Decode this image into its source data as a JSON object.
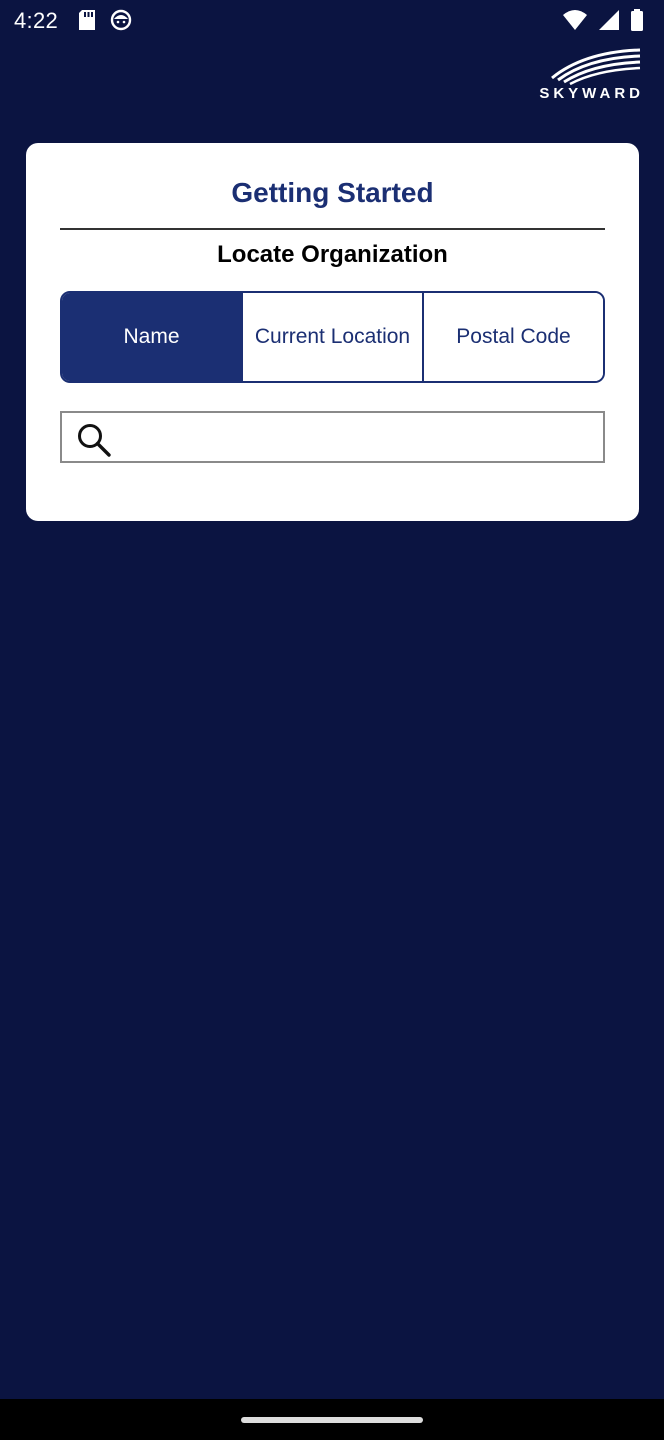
{
  "status_bar": {
    "time": "4:22",
    "icons": [
      "sd-card-icon",
      "notification-face-icon",
      "wifi-icon",
      "cellular-signal-icon",
      "battery-icon"
    ]
  },
  "logo": {
    "text": "SKYWARD"
  },
  "card": {
    "title": "Getting Started",
    "subtitle": "Locate Organization",
    "tabs": [
      {
        "label": "Name",
        "active": true
      },
      {
        "label": "Current Location",
        "active": false
      },
      {
        "label": "Postal Code",
        "active": false
      }
    ],
    "search": {
      "value": "",
      "placeholder": ""
    }
  },
  "colors": {
    "background": "#0b1441",
    "accent": "#1b2f73",
    "card": "#ffffff"
  }
}
